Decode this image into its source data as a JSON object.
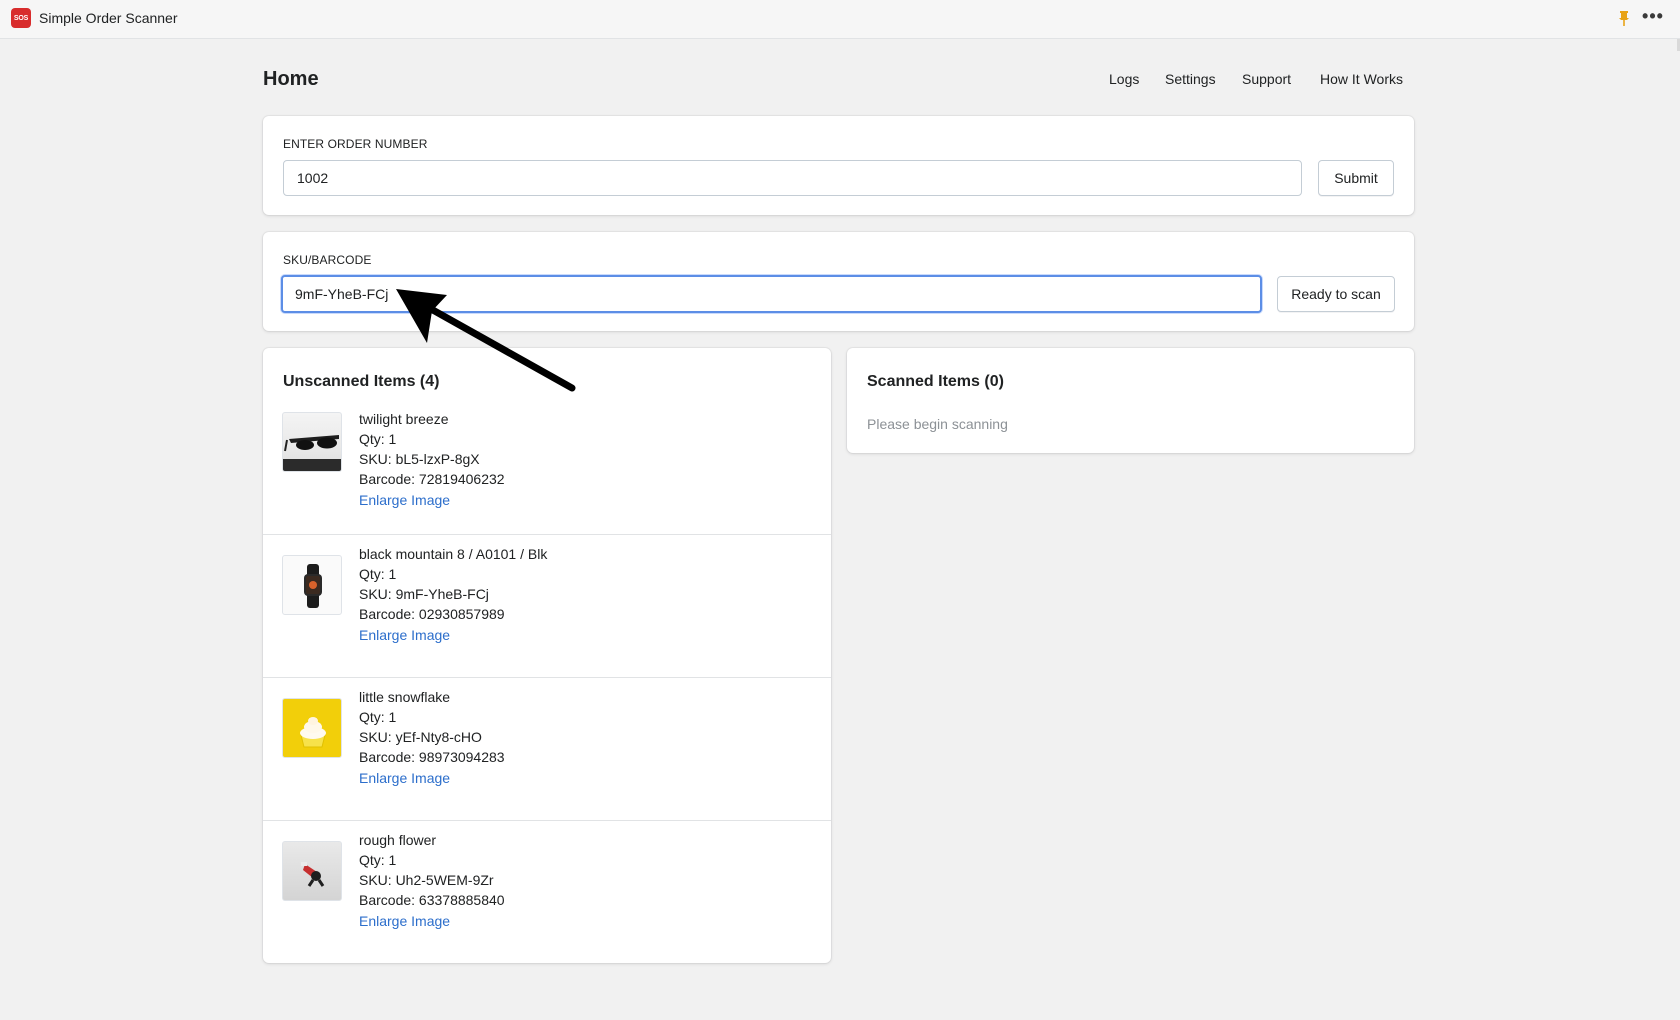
{
  "window": {
    "logo_text": "SOS",
    "title": "Simple Order Scanner",
    "pin_icon": "pin-icon",
    "more_icon": "ellipsis-icon",
    "more_glyph": "•••"
  },
  "header": {
    "page_title": "Home",
    "nav": [
      "Logs",
      "Settings",
      "Support",
      "How It Works"
    ]
  },
  "order": {
    "label": "ENTER ORDER NUMBER",
    "value": "1002",
    "submit_label": "Submit"
  },
  "scan": {
    "label": "SKU/BARCODE",
    "value": "9mF-YheB-FCj",
    "status_button": "Ready to scan"
  },
  "unscanned": {
    "heading": "Unscanned Items (4)",
    "items": [
      {
        "name": "twilight breeze",
        "qty": "Qty: 1",
        "sku": "SKU: bL5-lzxP-8gX",
        "barcode": "Barcode: 72819406232",
        "link": "Enlarge Image",
        "image": "sunglasses"
      },
      {
        "name": "black mountain 8 / A0101 / Blk",
        "qty": "Qty: 1",
        "sku": "SKU: 9mF-YheB-FCj",
        "barcode": "Barcode: 02930857989",
        "link": "Enlarge Image",
        "image": "smartwatch"
      },
      {
        "name": "little snowflake",
        "qty": "Qty: 1",
        "sku": "SKU: yEf-Nty8-cHO",
        "barcode": "Barcode: 98973094283",
        "link": "Enlarge Image",
        "image": "cupcake"
      },
      {
        "name": "rough flower",
        "qty": "Qty: 1",
        "sku": "SKU: Uh2-5WEM-9Zr",
        "barcode": "Barcode: 63378885840",
        "link": "Enlarge Image",
        "image": "toy-figure"
      }
    ]
  },
  "scanned": {
    "heading": "Scanned Items (0)",
    "empty_message": "Please begin scanning"
  },
  "colors": {
    "brand_red": "#d82c2c",
    "link_blue": "#2c6ecb",
    "focus_blue": "#5c8ee6",
    "pin_orange": "#e8a317",
    "cupcake_yellow": "#f2cf0a"
  }
}
